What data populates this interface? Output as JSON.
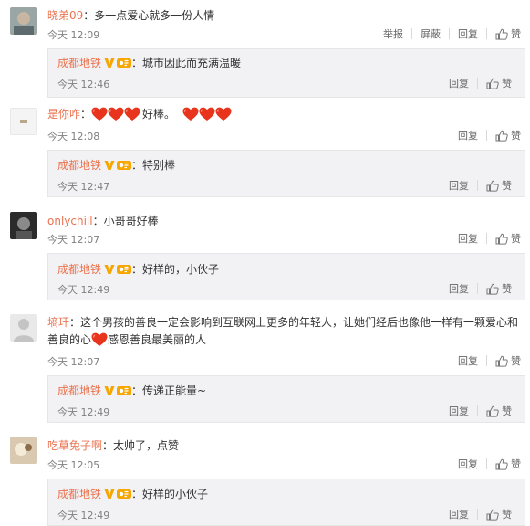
{
  "labels": {
    "report": "举报",
    "block": "屏蔽",
    "reply": "回复",
    "like": "赞"
  },
  "comments": [
    {
      "user": "晓弟09",
      "sep": "：",
      "text": "多一点爱心就多一份人情",
      "time": "今天 12:09",
      "reply": {
        "user": "成都地铁",
        "sep": "：",
        "text": "城市因此而充满温暖",
        "time": "今天 12:46"
      }
    },
    {
      "user": "是你咋",
      "sep": "：",
      "text_after": "好棒。",
      "time": "今天 12:08",
      "reply": {
        "user": "成都地铁",
        "sep": "：",
        "text": "特别棒",
        "time": "今天 12:47"
      }
    },
    {
      "user": "onlychill",
      "sep": "：",
      "text": "小哥哥好棒",
      "time": "今天 12:07",
      "reply": {
        "user": "成都地铁",
        "sep": "：",
        "text": "好样的，小伙子",
        "time": "今天 12:49"
      }
    },
    {
      "user": "墒玕",
      "sep": "：",
      "text": "这个男孩的善良一定会影响到互联网上更多的年轻人，让她们经后也像他一样有一颗爱心和",
      "text2a": "善良的心",
      "text2b": "感恩善良最美丽的人",
      "time": "今天 12:07",
      "reply": {
        "user": "成都地铁",
        "sep": "：",
        "text": "传递正能量~",
        "time": "今天 12:49"
      }
    },
    {
      "user": "吃草兔子啊",
      "sep": "：",
      "text": "太帅了，点赞",
      "time": "今天 12:05",
      "reply": {
        "user": "成都地铁",
        "sep": "：",
        "text": "好样的小伙子",
        "time": "今天 12:49"
      }
    }
  ],
  "icons": {
    "like": "thumbs-up-icon",
    "verified": "verified-v-icon",
    "member": "member-badge-icon",
    "heart": "heart-emoji-icon"
  },
  "colors": {
    "username": "#eb7350",
    "meta": "#808080",
    "reply_bg": "#f2f2f5",
    "heart": "#e8341c",
    "verified": "#f7a600"
  }
}
